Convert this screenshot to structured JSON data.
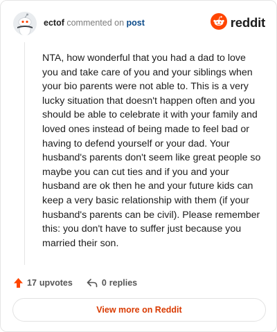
{
  "header": {
    "author": "ectof",
    "action_text": "commented on",
    "post_link_label": "post",
    "brand_name": "reddit"
  },
  "comment": {
    "text": "NTA, how wonderful that you had a dad to love you and take care of you and your siblings when your bio parents were not able to. This is a very lucky situation that doesn't happen often and you should be able to celebrate it with your family and loved ones instead of being made to feel bad or having to defend yourself or your dad. Your husband's parents don't seem like great people so maybe you can cut ties and if you and your husband are ok then he and your future kids can keep a very basic relationship with them (if your husband's parents can be civil). Please remember this: you don't have to suffer just because you married their son."
  },
  "actions": {
    "upvote_count": "17",
    "upvote_label": "upvotes",
    "reply_count": "0",
    "reply_label": "replies"
  },
  "footer": {
    "view_more_label": "View more on Reddit"
  },
  "colors": {
    "brand_orange": "#ff4500",
    "link_blue": "#0a4a8a",
    "view_more_text": "#d93a00"
  },
  "icons": {
    "avatar": "snoo-avatar-icon",
    "brand": "reddit-logo-icon",
    "upvote": "upvote-arrow-icon",
    "reply": "reply-arrow-icon"
  }
}
